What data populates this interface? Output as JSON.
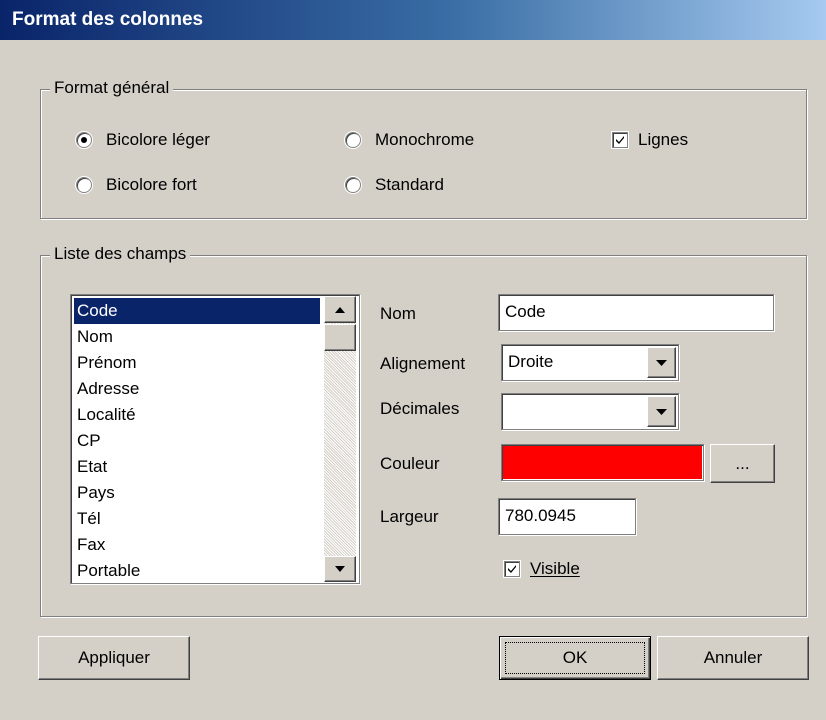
{
  "window": {
    "title": "Format des colonnes"
  },
  "format_general": {
    "legend": "Format général",
    "options": [
      {
        "label": "Bicolore léger",
        "selected": true
      },
      {
        "label": "Monochrome",
        "selected": false
      },
      {
        "label": "Bicolore fort",
        "selected": false
      },
      {
        "label": "Standard",
        "selected": false
      }
    ],
    "lignes": {
      "label": "Lignes",
      "checked": true
    }
  },
  "fields": {
    "legend": "Liste des champs",
    "list": [
      "Code",
      "Nom",
      "Prénom",
      "Adresse",
      "Localité",
      "CP",
      "Etat",
      "Pays",
      "Tél",
      "Fax",
      "Portable"
    ],
    "selected_index": 0,
    "nom": {
      "label": "Nom",
      "value": "Code"
    },
    "alignement": {
      "label": "Alignement",
      "value": "Droite"
    },
    "decimales": {
      "label": "Décimales",
      "value": ""
    },
    "couleur": {
      "label": "Couleur",
      "value": "#ff0000",
      "button": "..."
    },
    "largeur": {
      "label": "Largeur",
      "value": "780.0945"
    },
    "visible": {
      "label": "Visible",
      "checked": true
    }
  },
  "buttons": {
    "appliquer": "Appliquer",
    "ok": "OK",
    "annuler": "Annuler"
  }
}
